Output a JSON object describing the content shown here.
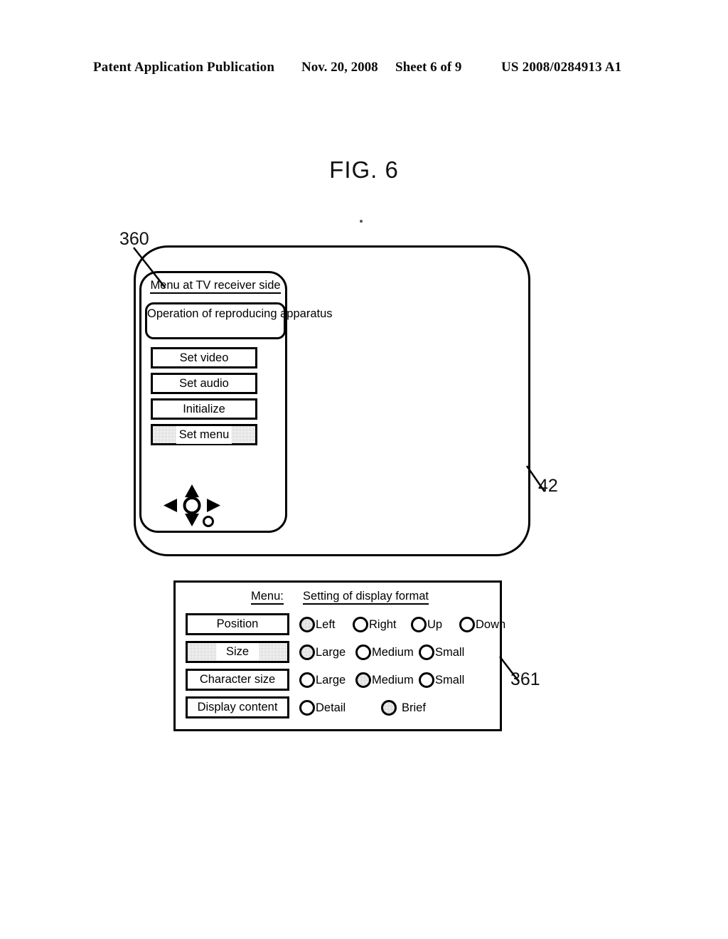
{
  "header": {
    "publication": "Patent Application Publication",
    "date": "Nov. 20, 2008",
    "sheet": "Sheet 6 of 9",
    "patent_number": "US 2008/0284913 A1"
  },
  "figure": {
    "title": "FIG. 6"
  },
  "reference_numerals": {
    "menu_panel": "360",
    "tv_screen": "42",
    "settings_dialog": "361"
  },
  "tv_menu": {
    "title": "Menu at TV receiver side",
    "items": [
      {
        "label": "Operation of reproducing apparatus",
        "selected": false,
        "shape": "rounded"
      },
      {
        "label": "Set video",
        "selected": false,
        "shape": "rect"
      },
      {
        "label": "Set audio",
        "selected": false,
        "shape": "rect"
      },
      {
        "label": "Initialize",
        "selected": false,
        "shape": "rect"
      },
      {
        "label": "Set menu",
        "selected": true,
        "shape": "rect"
      }
    ],
    "dpad": {
      "up": "up-arrow",
      "down": "down-arrow",
      "left": "left-arrow",
      "right": "right-arrow",
      "center": "enter-button",
      "extra": "secondary-button"
    }
  },
  "settings_dialog": {
    "title_label": "Menu:",
    "title_value": "Setting of display format",
    "rows": [
      {
        "label": "Position",
        "label_selected": false,
        "options": [
          {
            "label": "Left",
            "selected": true
          },
          {
            "label": "Right",
            "selected": false
          },
          {
            "label": "Up",
            "selected": false
          },
          {
            "label": "Down",
            "selected": false
          }
        ]
      },
      {
        "label": "Size",
        "label_selected": true,
        "options": [
          {
            "label": "Large",
            "selected": true
          },
          {
            "label": "Medium",
            "selected": false
          },
          {
            "label": "Small",
            "selected": false
          }
        ]
      },
      {
        "label": "Character size",
        "label_selected": false,
        "options": [
          {
            "label": "Large",
            "selected": false
          },
          {
            "label": "Medium",
            "selected": true
          },
          {
            "label": "Small",
            "selected": false
          }
        ]
      },
      {
        "label": "Display content",
        "label_selected": false,
        "options": [
          {
            "label": "Detail",
            "selected": false
          },
          {
            "label": "Brief",
            "selected": true
          }
        ]
      }
    ]
  },
  "colors": {
    "ink": "#000000",
    "paper": "#ffffff",
    "highlight": "#b8b8b8"
  }
}
